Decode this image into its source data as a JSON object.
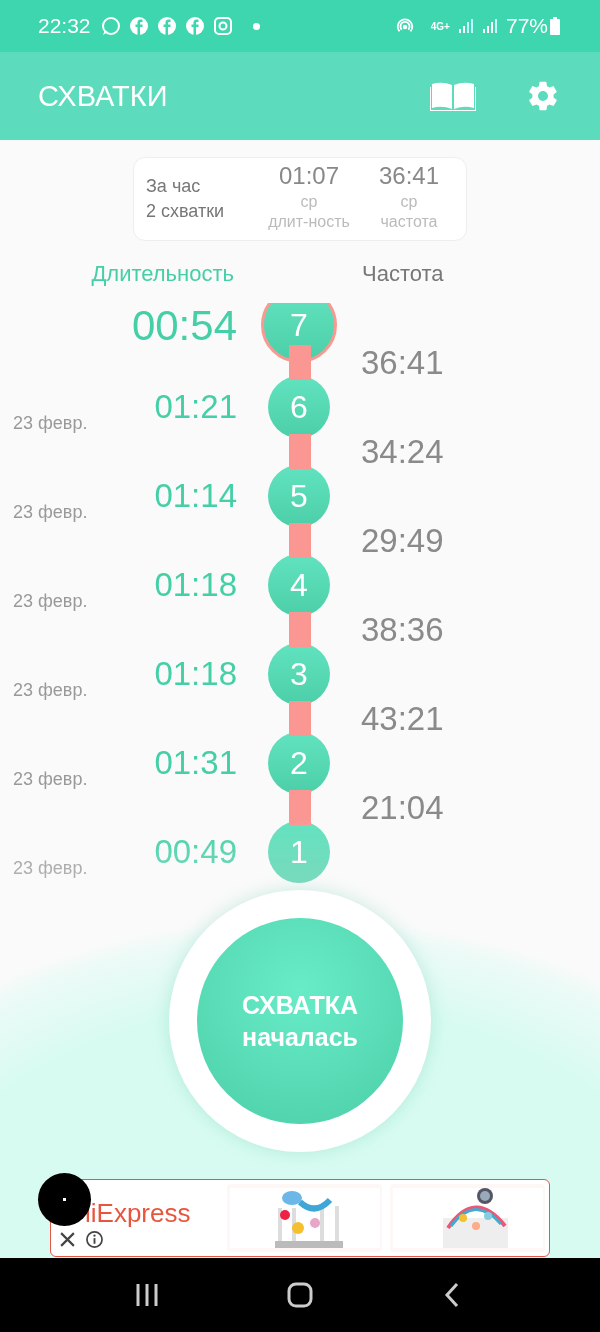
{
  "status_bar": {
    "time": "22:32",
    "network": "4G+",
    "battery": "77%"
  },
  "app_bar": {
    "title": "СХВАТКИ"
  },
  "summary": {
    "period": "За час",
    "count": "2 схватки",
    "stats": [
      {
        "value": "01:07",
        "label": "ср\nдлит-ность"
      },
      {
        "value": "36:41",
        "label": "ср\nчастота"
      }
    ]
  },
  "columns": {
    "duration": "Длительность",
    "frequency": "Частота"
  },
  "contractions": [
    {
      "number": "7",
      "duration": "00:54",
      "current": true,
      "frequency": "36:41"
    },
    {
      "number": "6",
      "date": "23 февр.",
      "duration": "01:21",
      "current": false,
      "frequency": "34:24"
    },
    {
      "number": "5",
      "date": "23 февр.",
      "duration": "01:14",
      "current": false,
      "frequency": "29:49"
    },
    {
      "number": "4",
      "date": "23 февр.",
      "duration": "01:18",
      "current": false,
      "frequency": "38:36"
    },
    {
      "number": "3",
      "date": "23 февр.",
      "duration": "01:18",
      "current": false,
      "frequency": "43:21"
    },
    {
      "number": "2",
      "date": "23 февр.",
      "duration": "01:31",
      "current": false,
      "frequency": "21:04"
    },
    {
      "number": "1",
      "date": "23 февр.",
      "duration": "00:49",
      "current": false
    }
  ],
  "main_button": {
    "line1": "СХВАТКА",
    "line2": "началась"
  },
  "ad": {
    "brand": "liExpress"
  }
}
